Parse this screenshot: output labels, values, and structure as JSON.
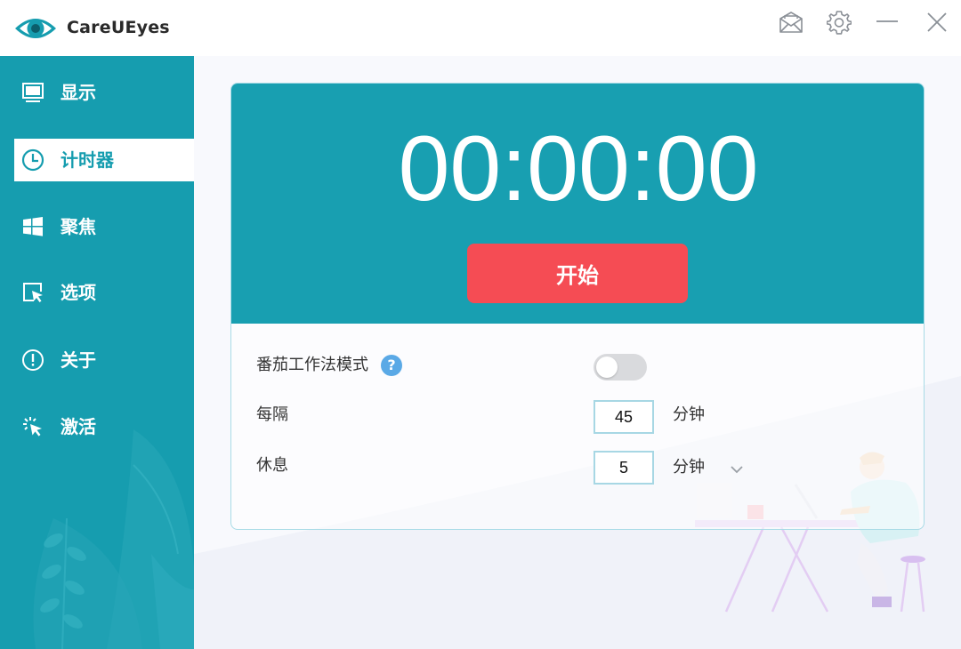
{
  "app": {
    "title": "CareUEyes",
    "accent_color": "#169daf"
  },
  "titlebar": {
    "icons": [
      "mail-icon",
      "gear-icon",
      "minimize-icon",
      "close-icon"
    ]
  },
  "sidebar": {
    "items": [
      {
        "label": "显示",
        "icon": "monitor-icon",
        "active": false
      },
      {
        "label": "计时器",
        "icon": "clock-icon",
        "active": true
      },
      {
        "label": "聚焦",
        "icon": "windows-icon",
        "active": false
      },
      {
        "label": "选项",
        "icon": "cursor-box-icon",
        "active": false
      },
      {
        "label": "关于",
        "icon": "info-circle-icon",
        "active": false
      },
      {
        "label": "激活",
        "icon": "activate-cursor-icon",
        "active": false
      }
    ]
  },
  "timer": {
    "display": "00:00:00",
    "start_label": "开始",
    "start_color": "#f54c54"
  },
  "settings": {
    "pomodoro_label": "番茄工作法模式",
    "pomodoro_help": "?",
    "pomodoro_enabled": false,
    "interval_label": "每隔",
    "interval_value": "45",
    "interval_unit": "分钟",
    "rest_label": "休息",
    "rest_value": "5",
    "rest_unit": "分钟"
  }
}
